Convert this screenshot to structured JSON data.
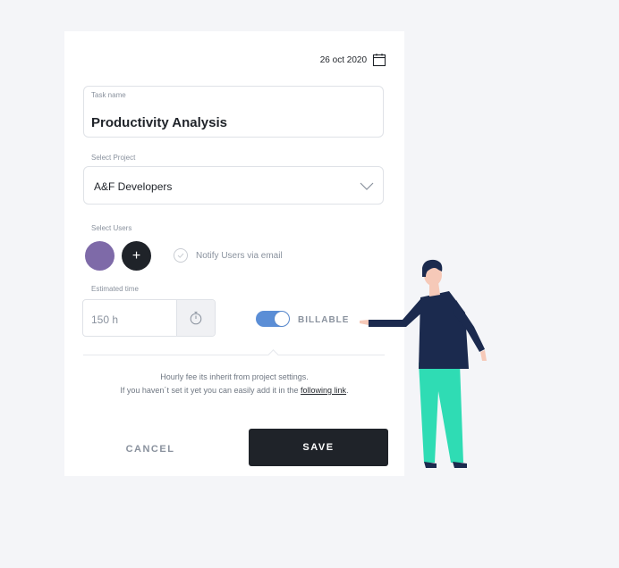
{
  "header": {
    "date": "26 oct 2020",
    "calendar_icon": "calendar-icon"
  },
  "task": {
    "label": "Task name",
    "value": "Productivity Analysis"
  },
  "project": {
    "label": "Select Project",
    "value": "A&F Developers",
    "icon": "chevron-down-icon"
  },
  "users": {
    "label": "Select Users",
    "avatar_color": "#7e6aa8",
    "add_symbol": "+",
    "notify_label": "Notify Users via email",
    "notify_checked": false
  },
  "time": {
    "label": "Estimated time",
    "value": "150 h",
    "icon": "stopwatch-icon"
  },
  "billable": {
    "label": "BILLABLE",
    "on": true,
    "color": "#5b8ed6"
  },
  "hint": {
    "line1": "Hourly fee its inherit from project settings.",
    "line2_prefix": "If you haven´t set it yet you can easily add it in the ",
    "link_text": "following link",
    "line2_suffix": "."
  },
  "actions": {
    "cancel": "CANCEL",
    "save": "SAVE"
  },
  "colors": {
    "dark": "#1f2329",
    "muted": "#8a929e",
    "accent": "#5b8ed6",
    "pants": "#2fdcb4",
    "sweater": "#1b2a4e"
  }
}
